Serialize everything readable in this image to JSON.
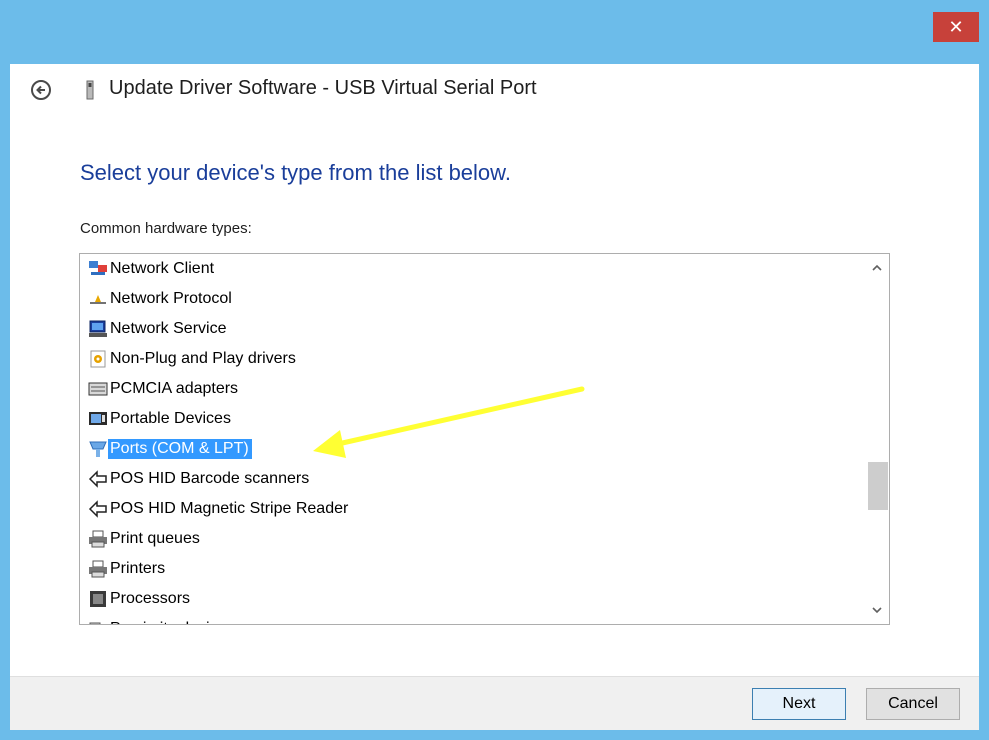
{
  "window": {
    "title": "Update Driver Software - USB Virtual Serial Port",
    "close_glyph": "✕"
  },
  "main": {
    "heading": "Select your device's type from the list below.",
    "list_label": "Common hardware types:"
  },
  "list": {
    "items": [
      {
        "label": "Network Client",
        "icon": "network-client-icon"
      },
      {
        "label": "Network Protocol",
        "icon": "network-protocol-icon"
      },
      {
        "label": "Network Service",
        "icon": "network-service-icon"
      },
      {
        "label": "Non-Plug and Play drivers",
        "icon": "non-pnp-drivers-icon"
      },
      {
        "label": "PCMCIA adapters",
        "icon": "pcmcia-icon"
      },
      {
        "label": "Portable Devices",
        "icon": "portable-devices-icon"
      },
      {
        "label": "Ports (COM & LPT)",
        "icon": "ports-icon",
        "selected": true
      },
      {
        "label": "POS HID Barcode scanners",
        "icon": "pos-hid-icon"
      },
      {
        "label": "POS HID Magnetic Stripe Reader",
        "icon": "pos-hid-icon"
      },
      {
        "label": "Print queues",
        "icon": "printer-icon"
      },
      {
        "label": "Printers",
        "icon": "printer-icon"
      },
      {
        "label": "Processors",
        "icon": "processor-icon"
      },
      {
        "label": "Proximity devices",
        "icon": "proximity-icon"
      }
    ],
    "selected_index": 6
  },
  "footer": {
    "next_label": "Next",
    "cancel_label": "Cancel"
  },
  "colors": {
    "titlebar": "#6cbcea",
    "close": "#c7413a",
    "heading": "#1a3e9a",
    "selection": "#3399ff",
    "annotation_arrow": "#ffff33"
  }
}
